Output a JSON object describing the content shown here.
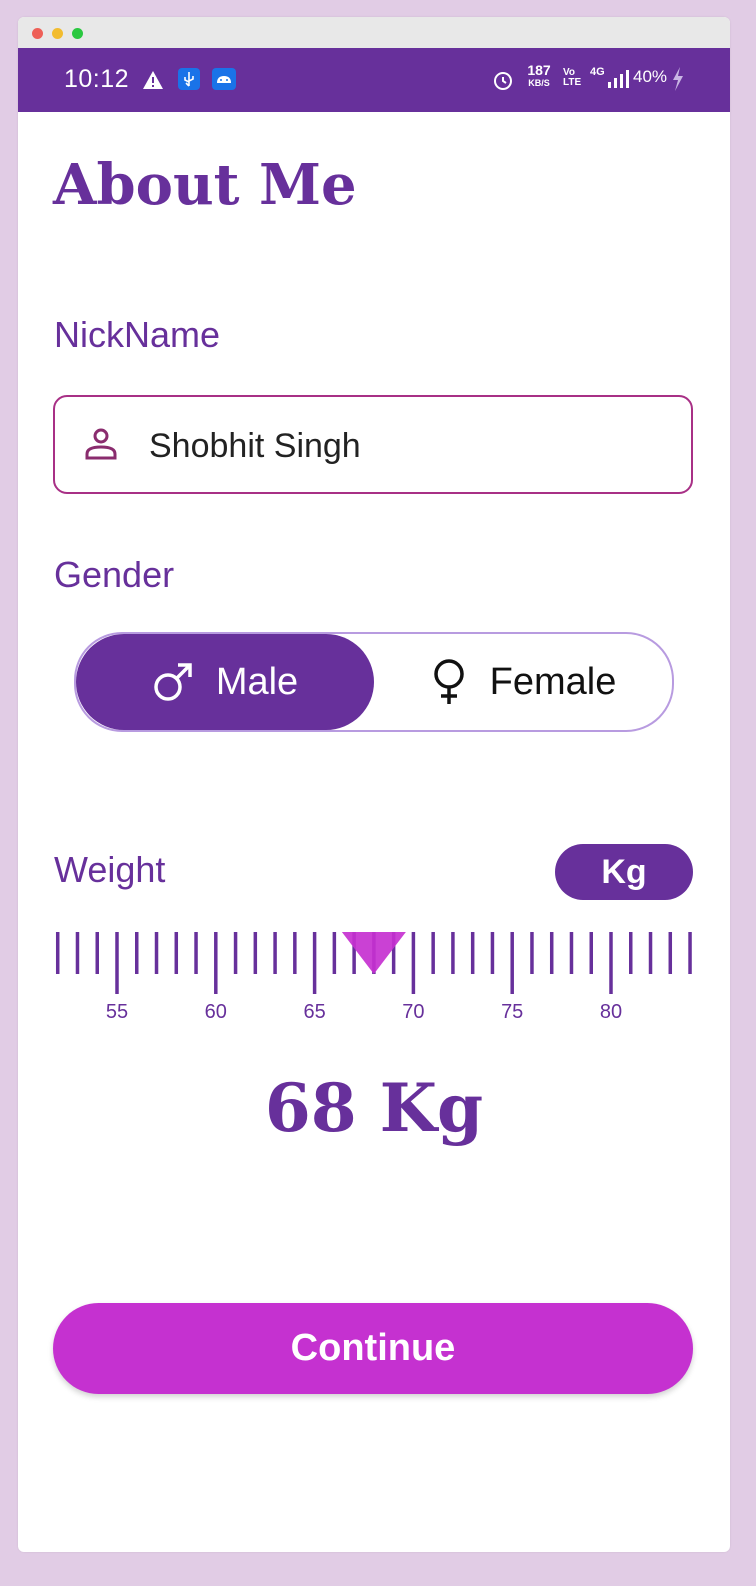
{
  "status_bar": {
    "time": "10:12",
    "speed_value": "187",
    "speed_unit": "KB/S",
    "volte_top": "Vo",
    "volte_bottom": "LTE",
    "network": "4G",
    "battery": "40%"
  },
  "page": {
    "title": "About Me"
  },
  "nickname": {
    "label": "NickName",
    "value": "Shobhit Singh",
    "icon": "person-icon"
  },
  "gender": {
    "label": "Gender",
    "options": [
      {
        "label": "Male",
        "icon": "male-icon",
        "selected": true
      },
      {
        "label": "Female",
        "icon": "female-icon",
        "selected": false
      }
    ]
  },
  "weight": {
    "label": "Weight",
    "unit": "Kg",
    "ruler_ticks": [
      "55",
      "60",
      "65",
      "70",
      "75",
      "80"
    ],
    "selected": 68,
    "display": "68 Kg"
  },
  "actions": {
    "continue_label": "Continue"
  },
  "colors": {
    "primary": "#67309b",
    "accent": "#c531d0",
    "field_border": "#a83086"
  }
}
